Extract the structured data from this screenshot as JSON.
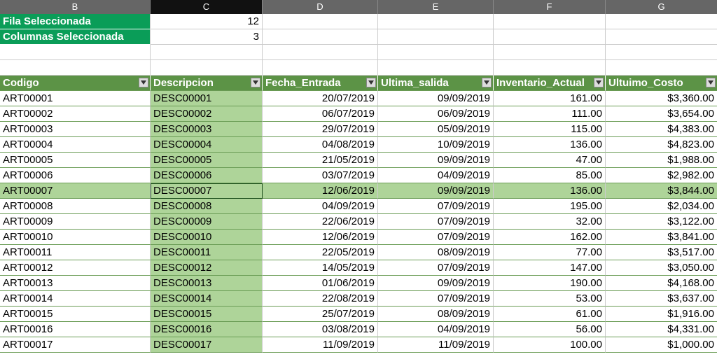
{
  "columns": [
    "B",
    "C",
    "D",
    "E",
    "F",
    "G"
  ],
  "selected_column": "C",
  "meta_rows": {
    "fila_label": "Fila Seleccionada",
    "fila_value": "12",
    "col_label": "Columnas Seleccionada",
    "col_value": "3"
  },
  "table_headers": {
    "codigo": "Codigo",
    "descripcion": "Descripcion",
    "fecha_entrada": "Fecha_Entrada",
    "ultima_salida": "Ultima_salida",
    "inventario_actual": "Inventario_Actual",
    "ultimo_costo": "Ultuimo_Costo"
  },
  "chart_data": {
    "type": "table",
    "columns": [
      "Codigo",
      "Descripcion",
      "Fecha_Entrada",
      "Ultima_salida",
      "Inventario_Actual",
      "Ultuimo_Costo"
    ],
    "rows": [
      [
        "ART00001",
        "DESC00001",
        "20/07/2019",
        "09/09/2019",
        "161.00",
        "$3,360.00"
      ],
      [
        "ART00002",
        "DESC00002",
        "06/07/2019",
        "06/09/2019",
        "111.00",
        "$3,654.00"
      ],
      [
        "ART00003",
        "DESC00003",
        "29/07/2019",
        "05/09/2019",
        "115.00",
        "$4,383.00"
      ],
      [
        "ART00004",
        "DESC00004",
        "04/08/2019",
        "10/09/2019",
        "136.00",
        "$4,823.00"
      ],
      [
        "ART00005",
        "DESC00005",
        "21/05/2019",
        "09/09/2019",
        "47.00",
        "$1,988.00"
      ],
      [
        "ART00006",
        "DESC00006",
        "03/07/2019",
        "04/09/2019",
        "85.00",
        "$2,982.00"
      ],
      [
        "ART00007",
        "DESC00007",
        "12/06/2019",
        "09/09/2019",
        "136.00",
        "$3,844.00"
      ],
      [
        "ART00008",
        "DESC00008",
        "04/09/2019",
        "07/09/2019",
        "195.00",
        "$2,034.00"
      ],
      [
        "ART00009",
        "DESC00009",
        "22/06/2019",
        "07/09/2019",
        "32.00",
        "$3,122.00"
      ],
      [
        "ART00010",
        "DESC00010",
        "12/06/2019",
        "07/09/2019",
        "162.00",
        "$3,841.00"
      ],
      [
        "ART00011",
        "DESC00011",
        "22/05/2019",
        "08/09/2019",
        "77.00",
        "$3,517.00"
      ],
      [
        "ART00012",
        "DESC00012",
        "14/05/2019",
        "07/09/2019",
        "147.00",
        "$3,050.00"
      ],
      [
        "ART00013",
        "DESC00013",
        "01/06/2019",
        "09/09/2019",
        "190.00",
        "$4,168.00"
      ],
      [
        "ART00014",
        "DESC00014",
        "22/08/2019",
        "07/09/2019",
        "53.00",
        "$3,637.00"
      ],
      [
        "ART00015",
        "DESC00015",
        "25/07/2019",
        "08/09/2019",
        "61.00",
        "$1,916.00"
      ],
      [
        "ART00016",
        "DESC00016",
        "03/08/2019",
        "04/09/2019",
        "56.00",
        "$4,331.00"
      ],
      [
        "ART00017",
        "DESC00017",
        "11/09/2019",
        "11/09/2019",
        "100.00",
        "$1,000.00"
      ]
    ],
    "highlighted_row_index": 6,
    "active_cell": {
      "row_index": 6,
      "col_index": 1
    }
  }
}
